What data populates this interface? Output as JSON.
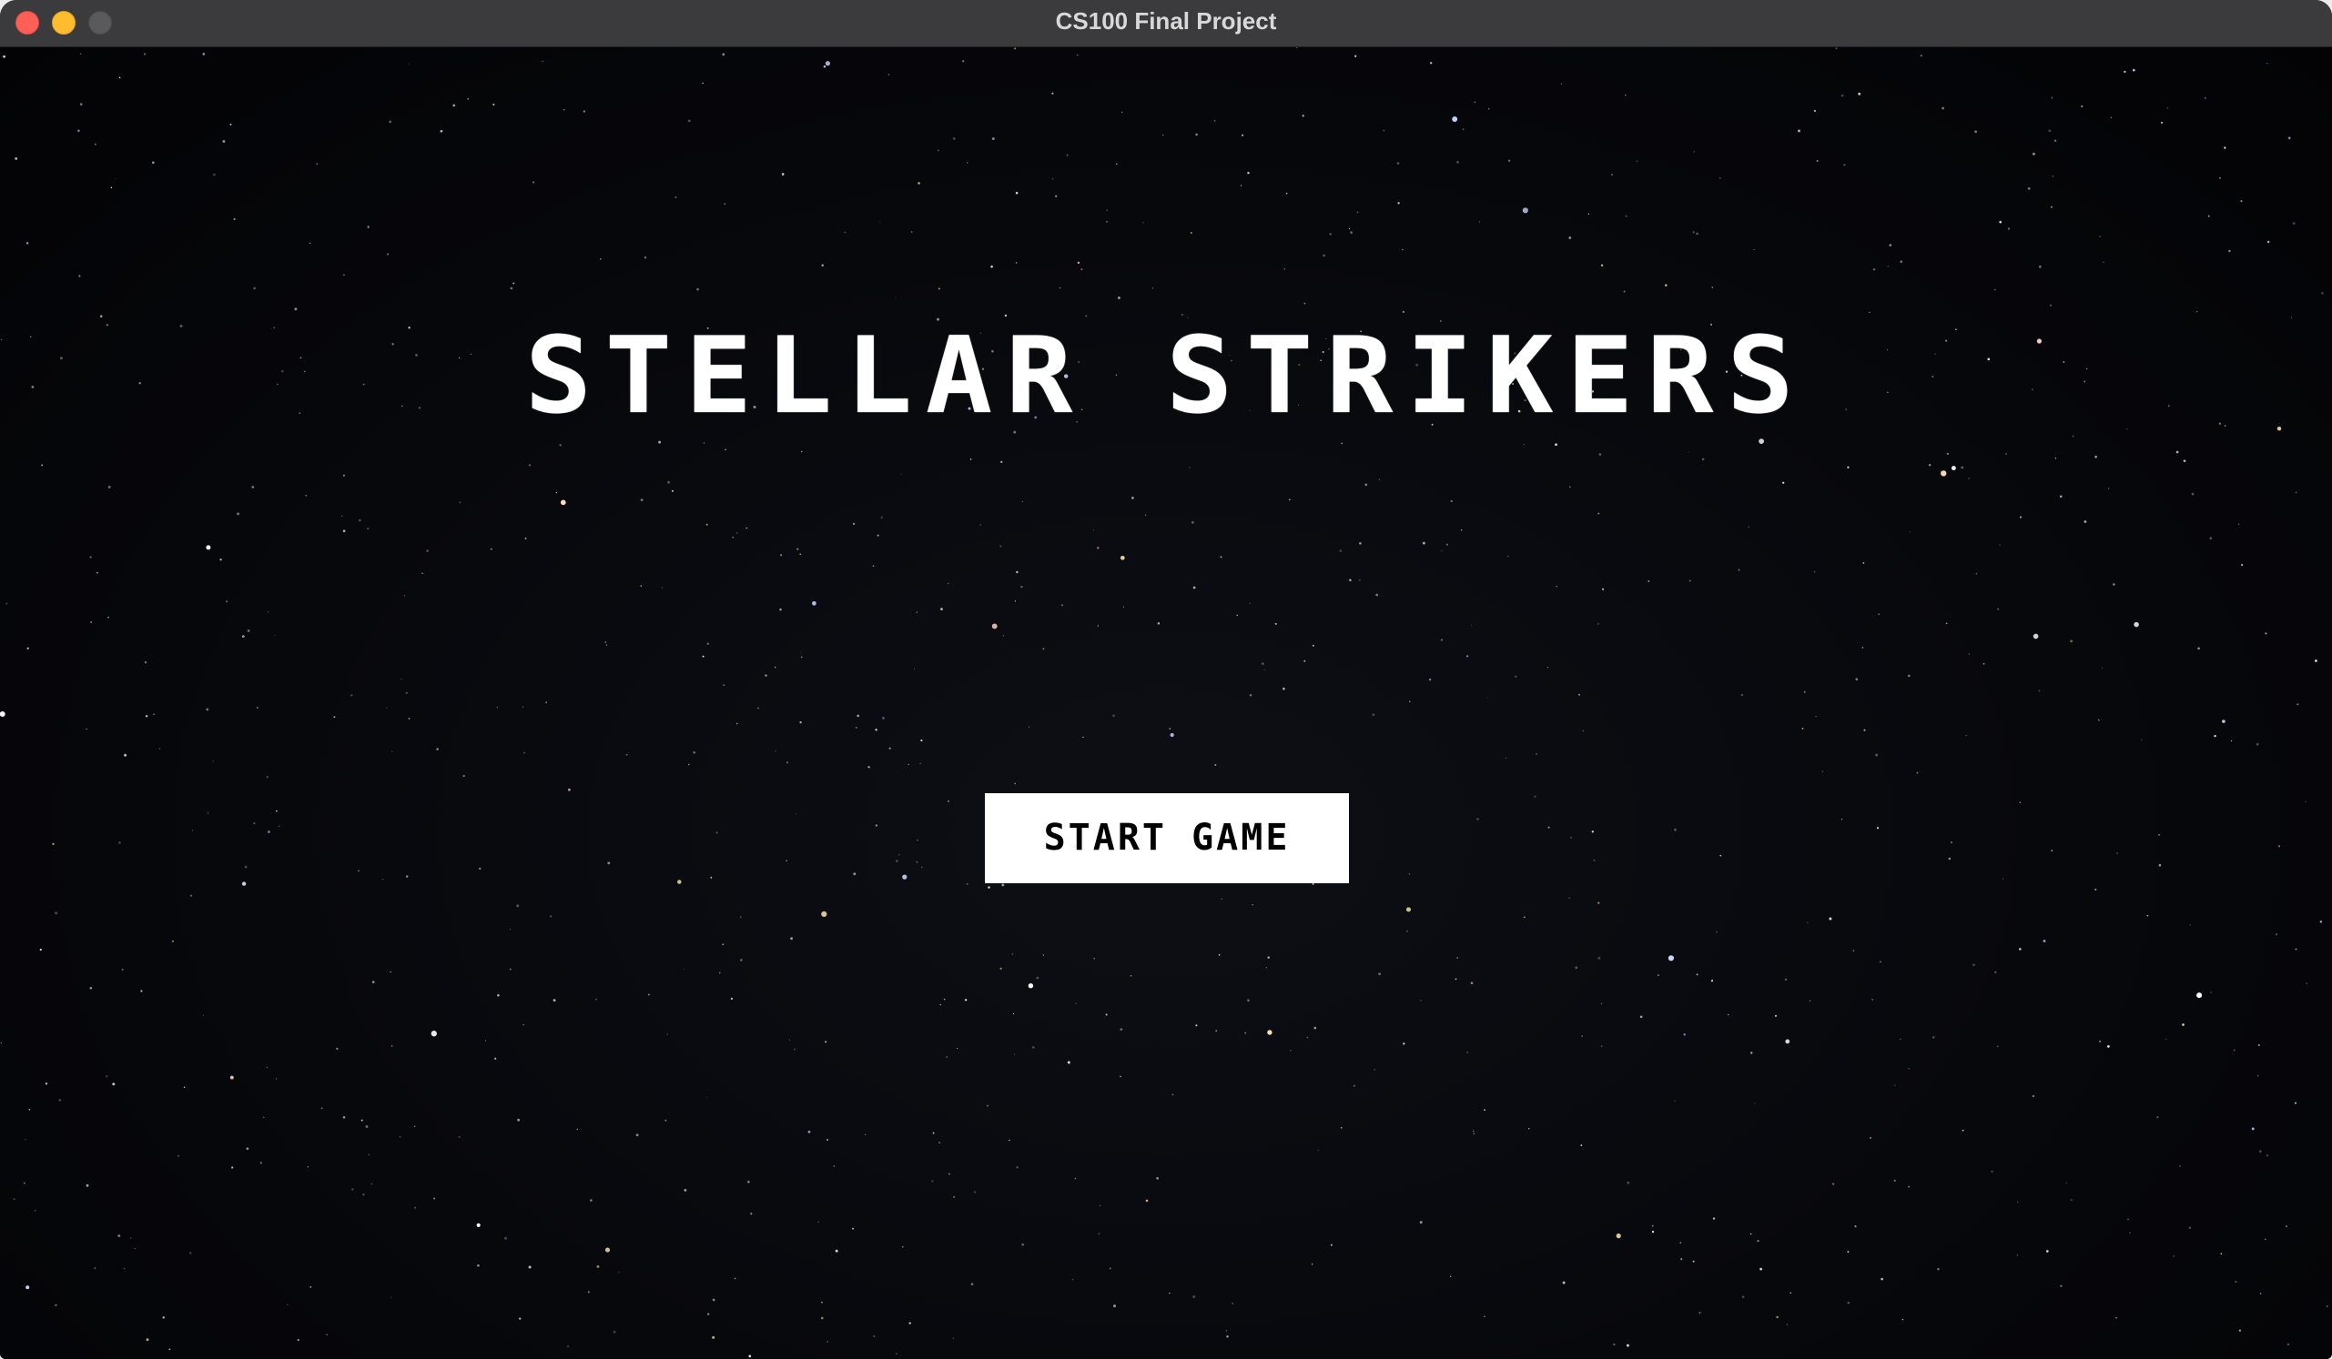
{
  "window": {
    "title": "CS100 Final Project"
  },
  "game": {
    "title": "STELLAR STRIKERS",
    "start_button_label": "START GAME"
  },
  "colors": {
    "background": "#05060a",
    "text": "#ffffff",
    "button_background": "#ffffff",
    "button_text": "#000000"
  }
}
